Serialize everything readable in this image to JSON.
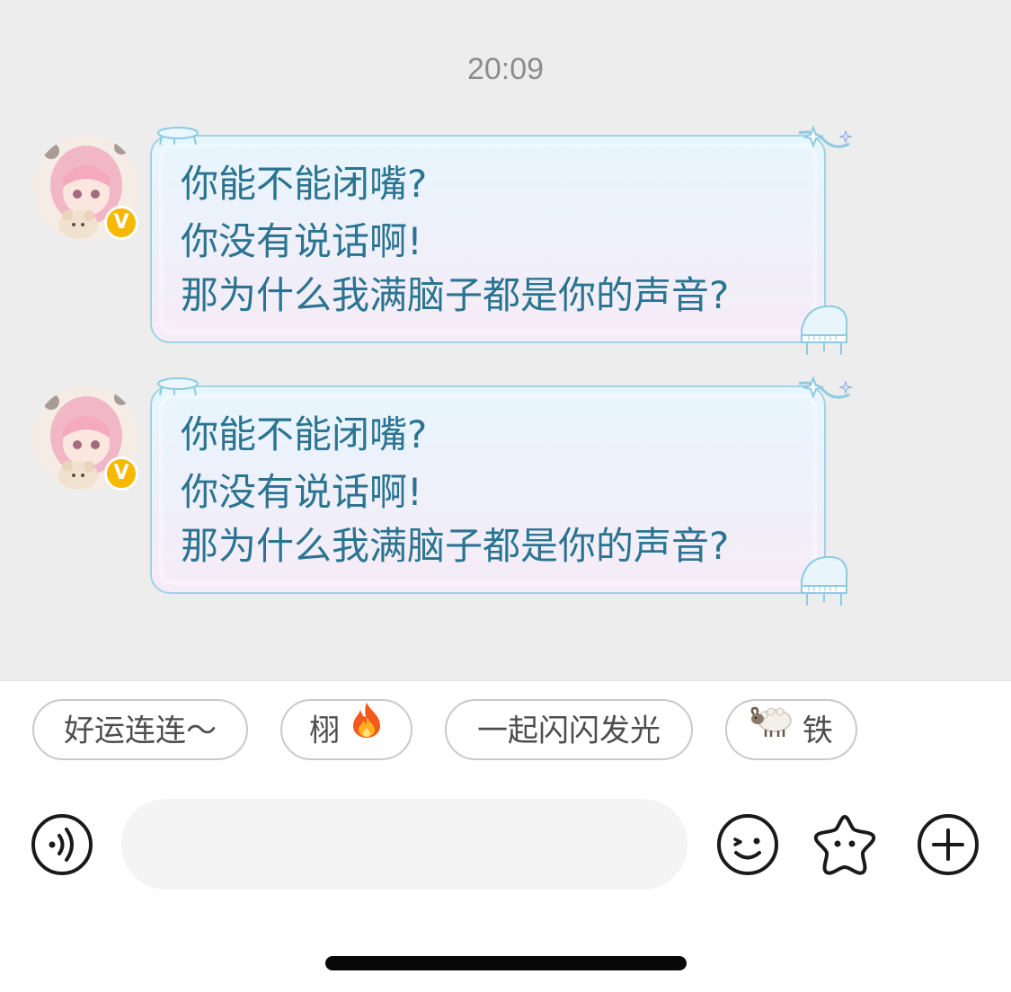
{
  "chat": {
    "timestamp": "20:09",
    "messages": [
      {
        "sender_verified_mark": "V",
        "lines": [
          "你能不能闭嘴?",
          "你没有说话啊!",
          "那为什么我满脑子都是你的声音?"
        ]
      },
      {
        "sender_verified_mark": "V",
        "lines": [
          "你能不能闭嘴?",
          "你没有说话啊!",
          "那为什么我满脑子都是你的声音?"
        ]
      }
    ]
  },
  "quick_replies": [
    {
      "text": "好运连连～",
      "emoji": ""
    },
    {
      "text": "栩",
      "emoji": "fire-emoji"
    },
    {
      "text": "一起闪闪发光",
      "emoji": ""
    },
    {
      "text": "铁",
      "emoji": "sheep-emoji"
    }
  ],
  "input_bar": {
    "placeholder": "",
    "value": "",
    "voice_icon": "voice-icon",
    "emoji_icon": "smiley-icon",
    "sticker_icon": "star-face-icon",
    "more_icon": "plus-icon"
  },
  "colors": {
    "chat_background": "#ededed",
    "bubble_text": "#2b7491",
    "bubble_border": "#9fd3e6",
    "badge": "#f6b800",
    "chip_border": "#c9c9c9"
  }
}
